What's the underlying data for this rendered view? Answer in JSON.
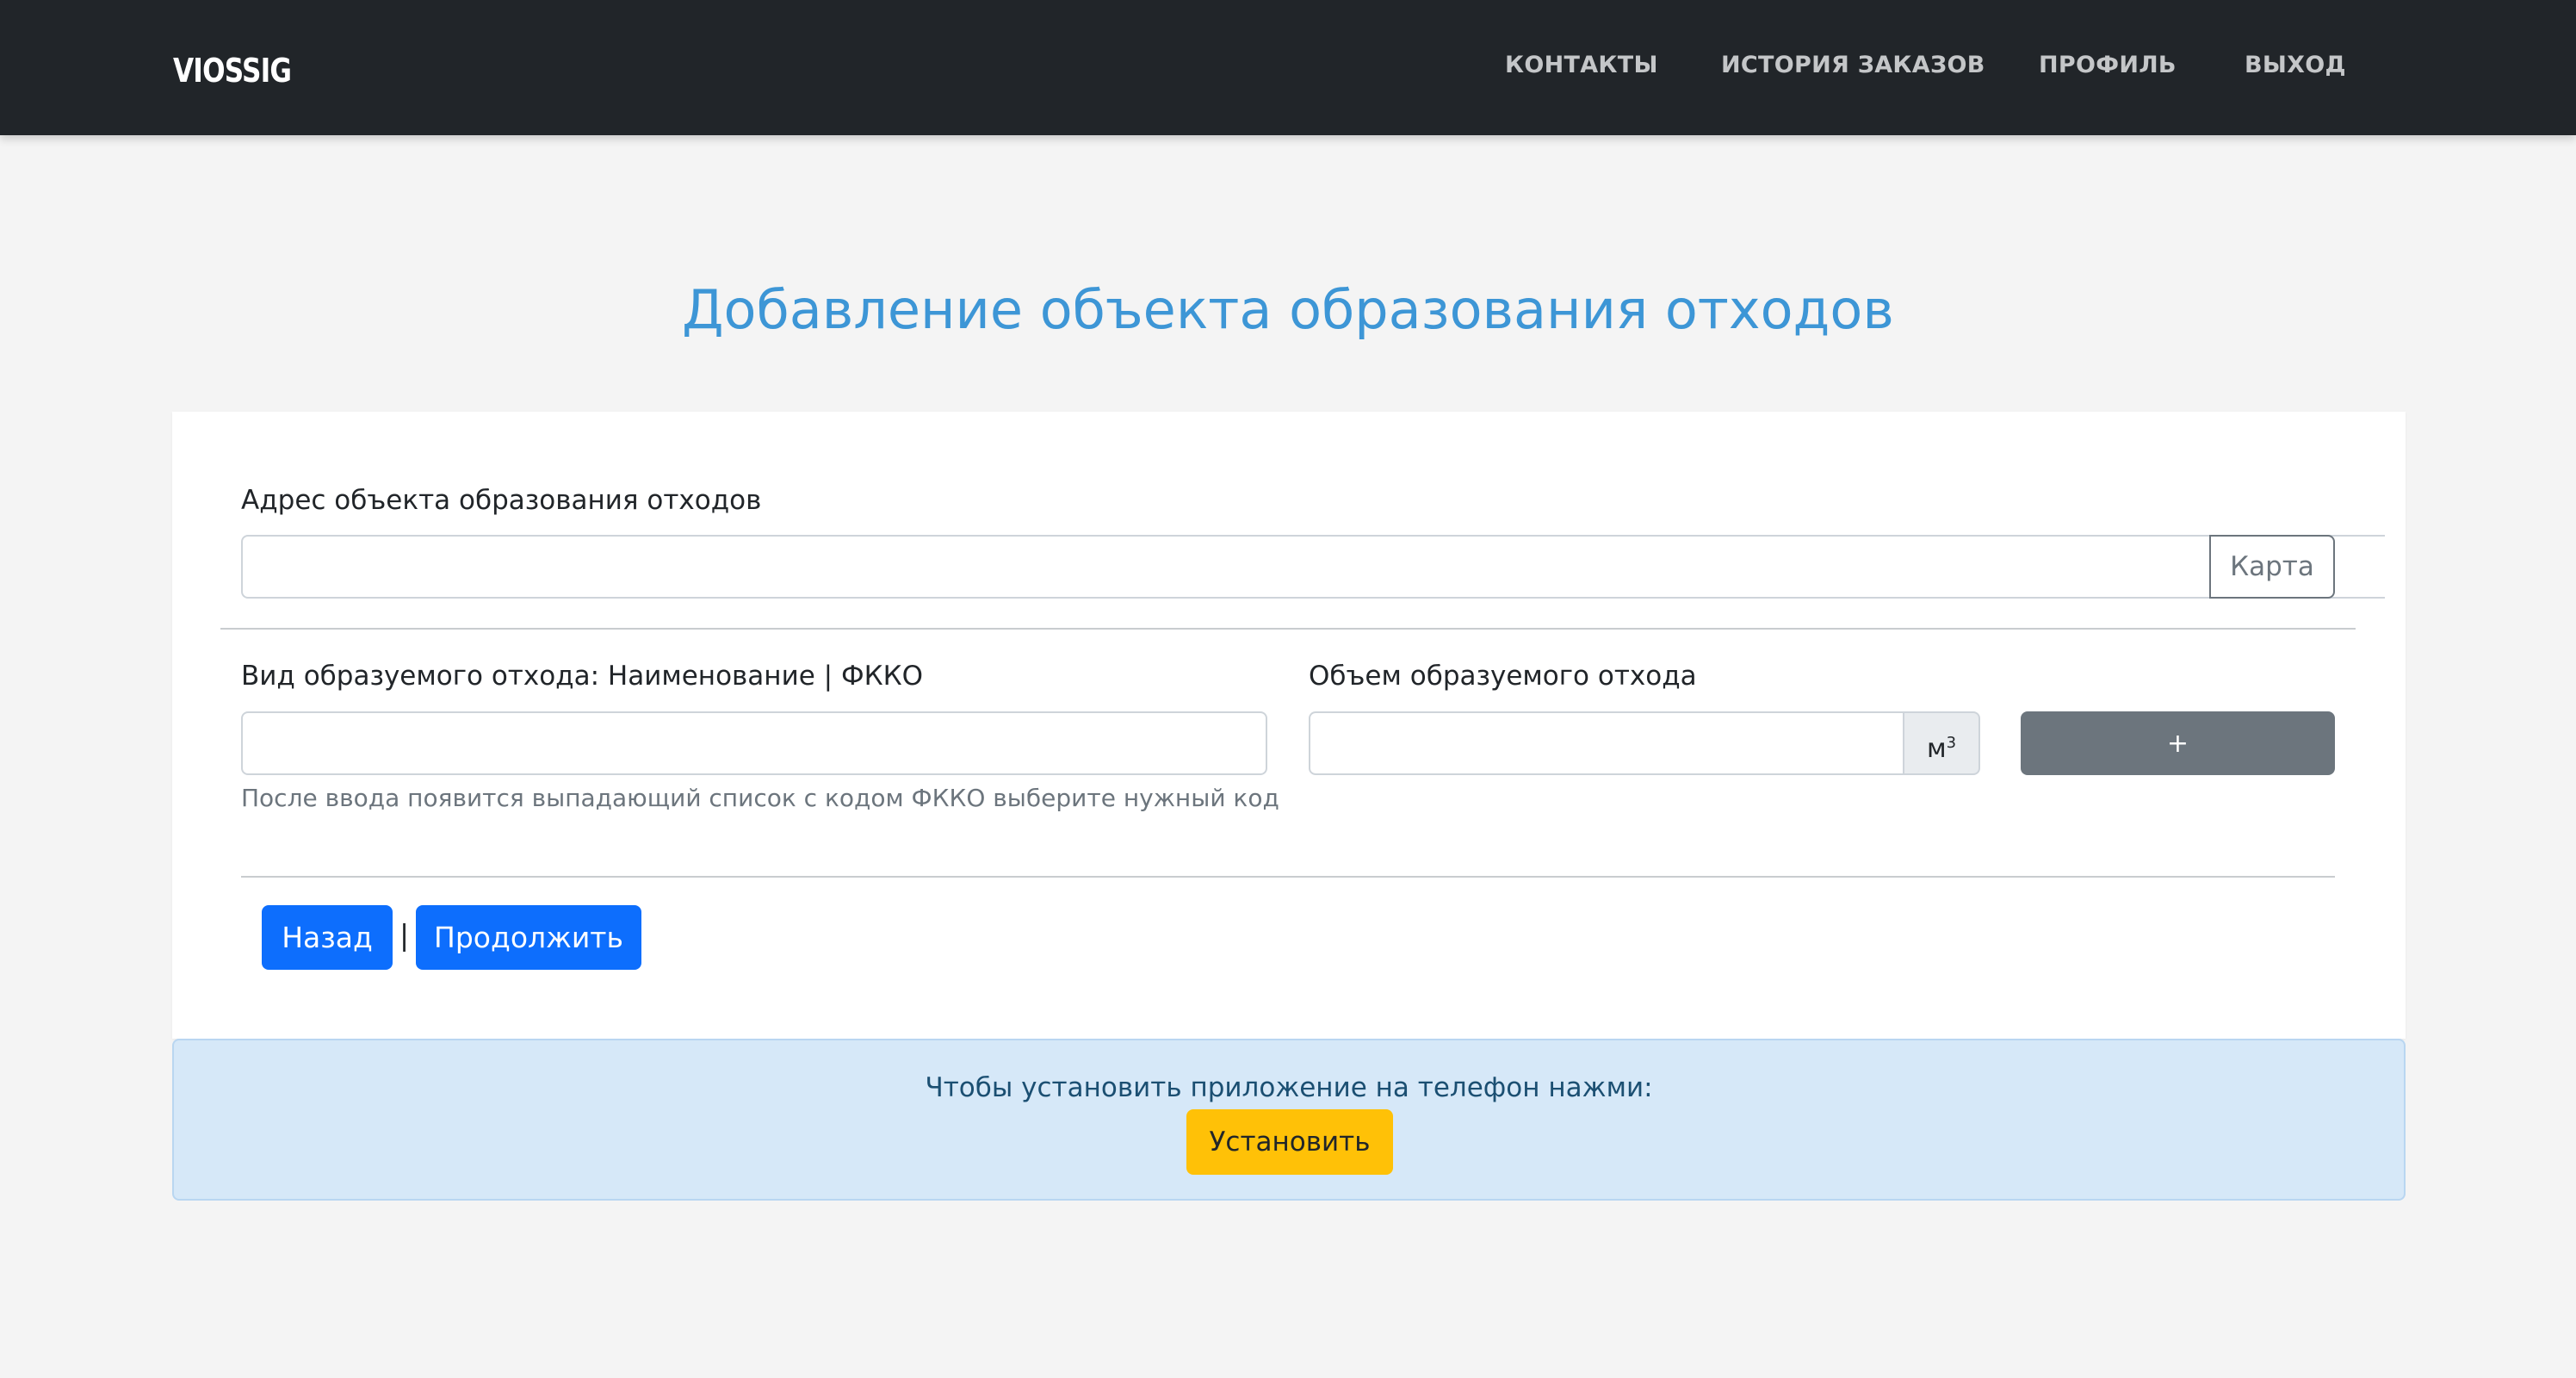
{
  "navbar": {
    "brand": "VIOSSIG",
    "links": [
      "КОНТАКТЫ",
      "ИСТОРИЯ ЗАКАЗОВ",
      "ПРОФИЛЬ",
      "ВЫХОД"
    ]
  },
  "page": {
    "title": "Добавление объекта образования отходов"
  },
  "form": {
    "address": {
      "label": "Адрес объекта образования отходов",
      "value": "",
      "placeholder": "",
      "map_button": "Карта"
    },
    "waste_type": {
      "label": "Вид образуемого отхода: Наименование | ФККО",
      "value": "",
      "placeholder": "",
      "help": "После ввода появится выпадающий список с кодом ФККО выберите нужный код"
    },
    "waste_volume": {
      "label": "Объем образуемого отхода",
      "value": "",
      "placeholder": "",
      "unit_base": "м",
      "unit_sup": "3"
    },
    "add_button": "+",
    "back_button": "Назад",
    "separator": "|",
    "continue_button": "Продолжить"
  },
  "install_banner": {
    "text": "Чтобы установить приложение на телефон нажми:",
    "button": "Установить"
  },
  "colors": {
    "navbar_bg": "#212529",
    "title": "#3d96d6",
    "primary": "#0d6efd",
    "secondary": "#6c757d",
    "warning": "#ffc107",
    "info_bg": "#d6e8f8"
  }
}
